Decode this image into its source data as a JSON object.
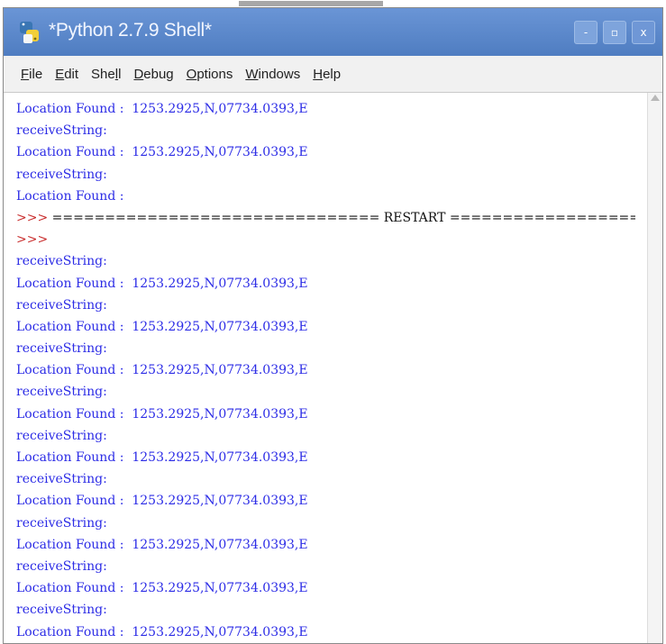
{
  "window": {
    "title": "*Python 2.7.9 Shell*",
    "title_bar_color": "#5b87c9",
    "controls": {
      "minimize": "-",
      "maximize": "▫",
      "close": "x"
    }
  },
  "menu": {
    "items": [
      {
        "mnemonic": "F",
        "rest": "ile"
      },
      {
        "mnemonic": "E",
        "rest": "dit"
      },
      {
        "pre": "She",
        "mnemonic": "l",
        "rest": "l"
      },
      {
        "mnemonic": "D",
        "rest": "ebug"
      },
      {
        "mnemonic": "O",
        "rest": "ptions"
      },
      {
        "mnemonic": "W",
        "rest": "indows"
      },
      {
        "mnemonic": "H",
        "rest": "elp"
      }
    ]
  },
  "shell": {
    "output_color": "#2c2ce6",
    "prompt_color": "#c82a2a",
    "lines": [
      {
        "kind": "out",
        "text": "Location Found :  1253.2925,N,07734.0393,E"
      },
      {
        "kind": "out",
        "text": "receiveString:"
      },
      {
        "kind": "out",
        "text": "Location Found :  1253.2925,N,07734.0393,E"
      },
      {
        "kind": "out",
        "text": "receiveString:"
      },
      {
        "kind": "out",
        "text": "Location Found :"
      },
      {
        "kind": "restart",
        "prompt": ">>> ",
        "text": "=============================== RESTART ==============================="
      },
      {
        "kind": "prompt",
        "text": ">>>"
      },
      {
        "kind": "out",
        "text": "receiveString:"
      },
      {
        "kind": "out",
        "text": "Location Found :  1253.2925,N,07734.0393,E"
      },
      {
        "kind": "out",
        "text": "receiveString:"
      },
      {
        "kind": "out",
        "text": "Location Found :  1253.2925,N,07734.0393,E"
      },
      {
        "kind": "out",
        "text": "receiveString:"
      },
      {
        "kind": "out",
        "text": "Location Found :  1253.2925,N,07734.0393,E"
      },
      {
        "kind": "out",
        "text": "receiveString:"
      },
      {
        "kind": "out",
        "text": "Location Found :  1253.2925,N,07734.0393,E"
      },
      {
        "kind": "out",
        "text": "receiveString:"
      },
      {
        "kind": "out",
        "text": "Location Found :  1253.2925,N,07734.0393,E"
      },
      {
        "kind": "out",
        "text": "receiveString:"
      },
      {
        "kind": "out",
        "text": "Location Found :  1253.2925,N,07734.0393,E"
      },
      {
        "kind": "out",
        "text": "receiveString:"
      },
      {
        "kind": "out",
        "text": "Location Found :  1253.2925,N,07734.0393,E"
      },
      {
        "kind": "out",
        "text": "receiveString:"
      },
      {
        "kind": "out",
        "text": "Location Found :  1253.2925,N,07734.0393,E"
      },
      {
        "kind": "out",
        "text": "receiveString:"
      },
      {
        "kind": "out",
        "text": "Location Found :  1253.2925,N,07734.0393,E"
      }
    ]
  }
}
